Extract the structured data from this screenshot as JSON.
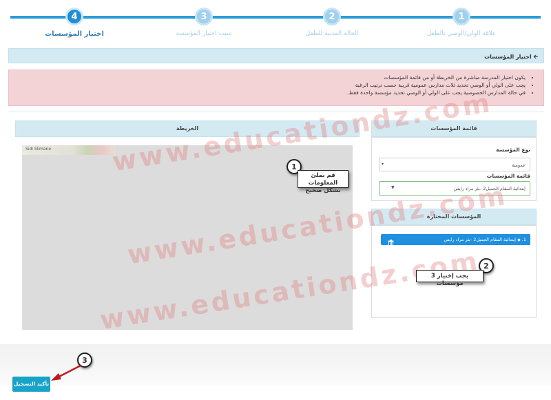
{
  "stepper": {
    "steps": [
      {
        "number": "1",
        "label": "علاقة الولي/الوصي بالطفل"
      },
      {
        "number": "2",
        "label": "الحالة المدنية للطفل"
      },
      {
        "number": "3",
        "label": "سبب اختيار المؤسسة"
      },
      {
        "number": "4",
        "label": "اختيار المؤسسات"
      }
    ]
  },
  "header": {
    "title": "اختيار المؤسسات",
    "back_arrow": "🡨"
  },
  "alert": {
    "items": [
      "يكون اختيار المدرسة مباشرة من الخريطة أو من قائمة المؤسسات",
      "يجب على الولي أو الوصي تحديد ثلاث مدارس عمومية قريبة حسب ترتيب الرغبة",
      "في حالة المدارس الخصوصية يجب على الولي أو الوصي تحديد مؤسسة واحدة فقط."
    ]
  },
  "map_panel": {
    "title": "الخريطة",
    "place_label": "Sidi Slimane"
  },
  "list_panel": {
    "title": "قائمة المؤسسات",
    "type_label": "نوع المؤسسة",
    "type_value": "عمومية",
    "list_label": "قائمة المؤسسات",
    "list_value": "إبتدائية المقام الجميل2 -بئر مراد رايس"
  },
  "selected_panel": {
    "title": "المؤسسات المختارة",
    "items": [
      {
        "index": "1.",
        "name": "إبتدائية المقام الجميل2 -بئر مراد رايس"
      }
    ]
  },
  "annotations": {
    "a1": {
      "number": "1",
      "line1": "قم بملئ المعلومات",
      "line2": "بشكل صحيح"
    },
    "a2": {
      "number": "2",
      "text": "يجب إختيار 3 مؤسسات"
    },
    "a3": {
      "number": "3"
    }
  },
  "watermark": {
    "text": "www.educationdz.com"
  },
  "footer": {
    "confirm_label": "تأكيد التسجيل"
  },
  "colors": {
    "accent": "#1e8fd6",
    "alert_bg": "#f3d3d6",
    "header_bg": "#d3eaf2",
    "selected_item": "#1f8fe0",
    "button": "#1aa3c9"
  }
}
